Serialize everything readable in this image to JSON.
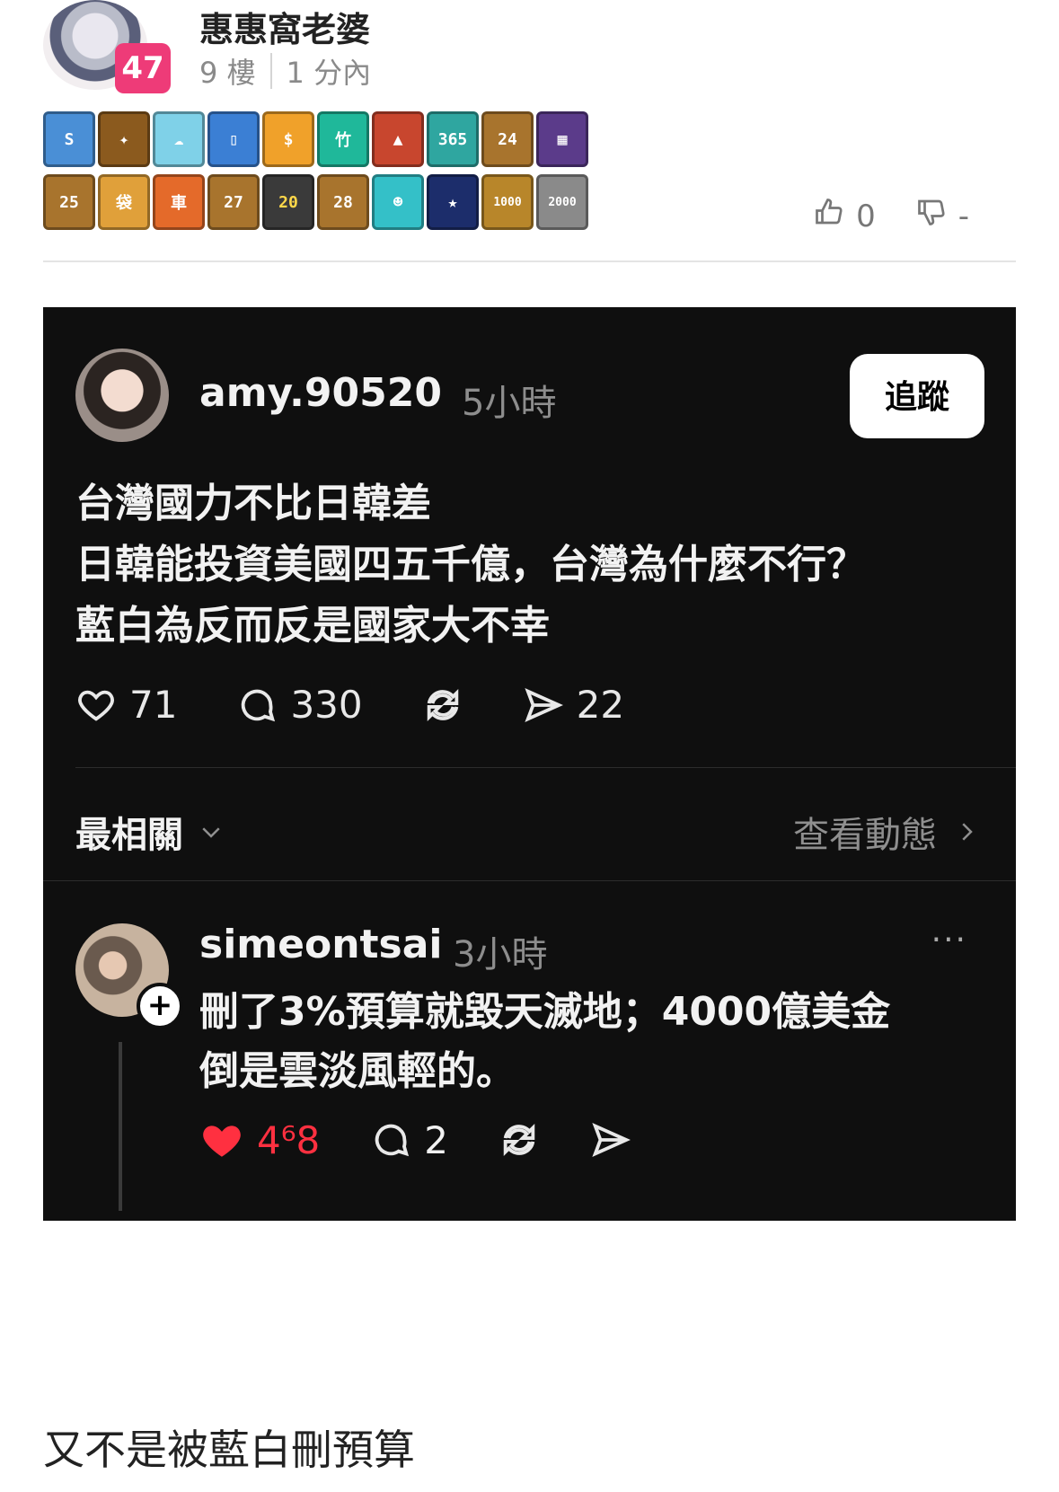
{
  "header": {
    "username": "惠惠窩老婆",
    "level": "47",
    "floor": "9 樓",
    "time": "1 分內",
    "likes": "0",
    "dislikes": "-"
  },
  "badges_row1": [
    "S",
    "✦",
    "☁",
    "▯",
    "$",
    "竹",
    "▲",
    "365",
    "24",
    "▦"
  ],
  "badges_row2": [
    "25",
    "袋",
    "車",
    "27",
    "20",
    "28",
    "☻",
    "★",
    "1000",
    "2000"
  ],
  "post": {
    "username": "amy.90520",
    "time": "5小時",
    "follow_label": "追蹤",
    "lines": [
      "台灣國力不比日韓差",
      "日韓能投資美國四五千億，台灣為什麼不行？",
      "藍白為反而反是國家大不幸"
    ],
    "likes": "71",
    "comments": "330",
    "shares": "22",
    "sort_label": "最相關",
    "activity_label": "查看動態"
  },
  "reply": {
    "username": "simeontsai",
    "time": "3小時",
    "more": "···",
    "lines": [
      "刪了3%預算就毀天滅地；4000億美金",
      "倒是雲淡風輕的。"
    ],
    "likes": "4⁶8",
    "comments": "2"
  },
  "comment_text": "又不是被藍白刪預算",
  "colors": {
    "level_badge": "#ee3b78",
    "dark_bg": "#0f0f0f",
    "heart": "#ff3040"
  }
}
